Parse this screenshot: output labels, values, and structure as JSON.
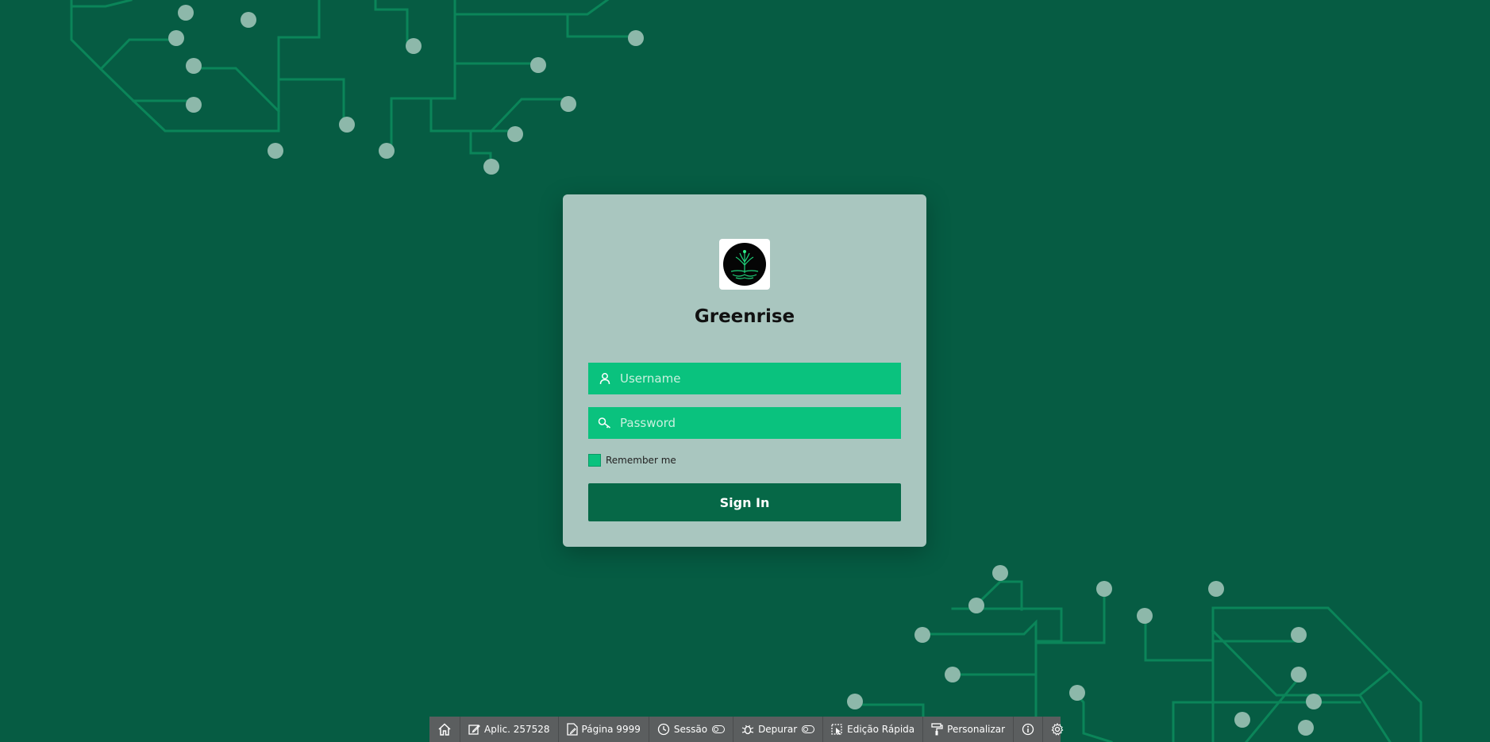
{
  "app": {
    "title": "Greenrise",
    "logo_icon": "seedling-logo-icon"
  },
  "login": {
    "username_placeholder": "Username",
    "password_placeholder": "Password",
    "remember_label": "Remember me",
    "remember_checked": false,
    "signin_label": "Sign In"
  },
  "devbar": {
    "home_icon": "home-icon",
    "app_label": "Aplic. 257528",
    "page_label": "Página 9999",
    "session_label": "Sessão",
    "debug_label": "Depurar",
    "quick_edit_label": "Edição Rápida",
    "customize_label": "Personalizar",
    "info_icon": "info-icon",
    "settings_icon": "gear-icon"
  },
  "colors": {
    "background": "#065c43",
    "card": "#a9c6bf",
    "field": "#0ac27e",
    "button": "#066847",
    "circuit_line": "#0a8a5c",
    "circuit_dot": "#8fb9ac",
    "devbar": "#5b5e5f"
  }
}
